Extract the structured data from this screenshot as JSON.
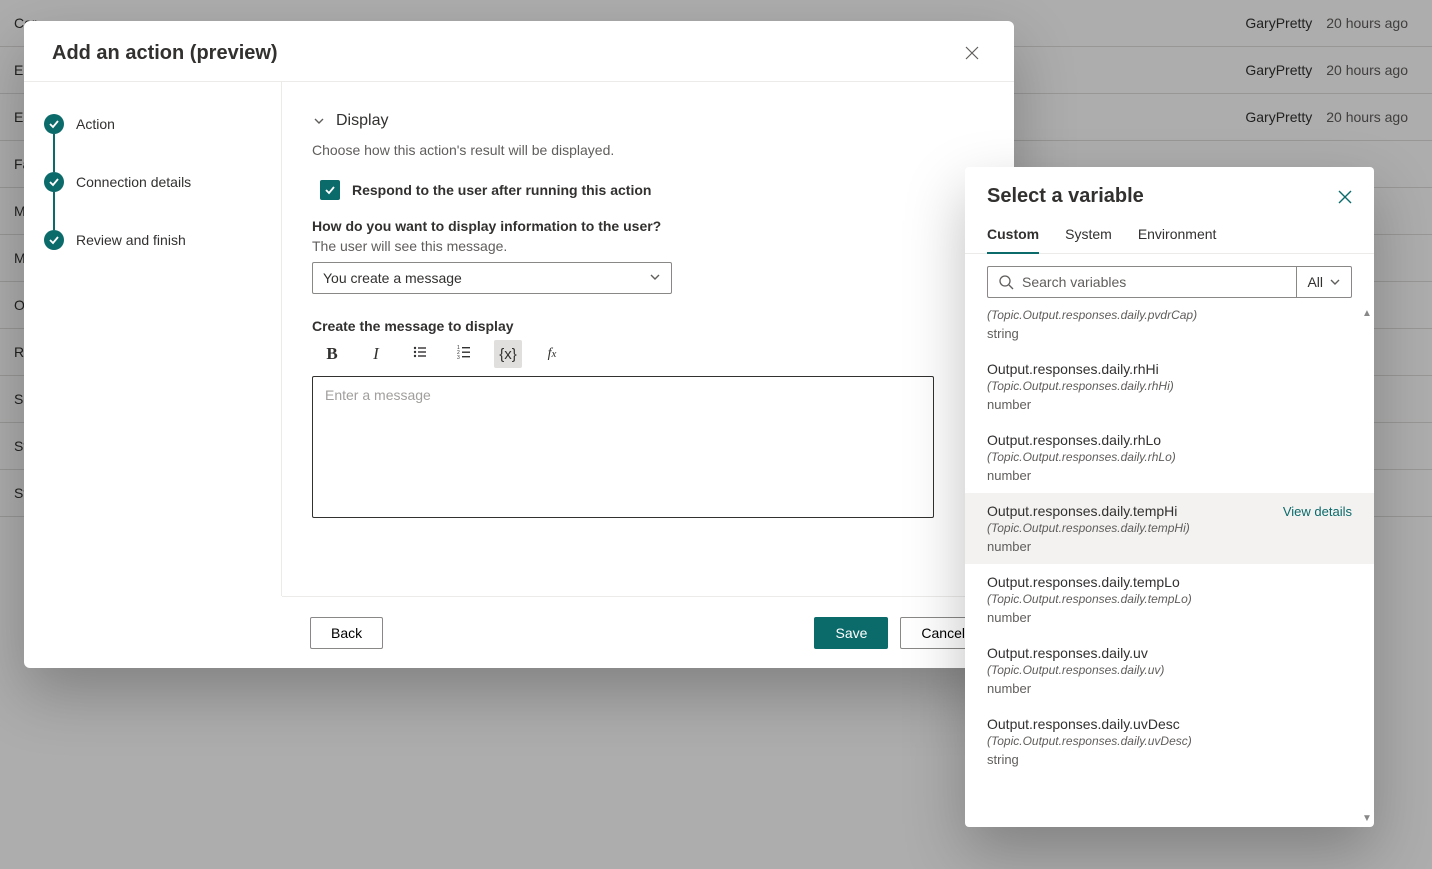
{
  "background_rows": [
    {
      "label": "Cor",
      "author": "GaryPretty",
      "time": "20 hours ago"
    },
    {
      "label": "End",
      "author": "GaryPretty",
      "time": "20 hours ago"
    },
    {
      "label": "Esc",
      "author": "GaryPretty",
      "time": "20 hours ago"
    },
    {
      "label": "Fall",
      "author": "",
      "time": ""
    },
    {
      "label": "MS",
      "author": "",
      "time": ""
    },
    {
      "label": "Mu",
      "author": "",
      "time": ""
    },
    {
      "label": "On",
      "author": "",
      "time": ""
    },
    {
      "label": "Res",
      "author": "",
      "time": ""
    },
    {
      "label": "Sig",
      "author": "",
      "time": ""
    },
    {
      "label": "Sta",
      "author": "",
      "time": ""
    },
    {
      "label": "Sta",
      "author": "",
      "time": ""
    }
  ],
  "modal": {
    "title": "Add an action (preview)",
    "steps": [
      "Action",
      "Connection details",
      "Review and finish"
    ],
    "section": {
      "title": "Display",
      "description": "Choose how this action's result will be displayed.",
      "respond_checkbox": "Respond to the user after running this action",
      "display_question": "How do you want to display information to the user?",
      "display_sub": "The user will see this message.",
      "select_value": "You create a message",
      "create_label": "Create the message to display",
      "editor_placeholder": "Enter a message",
      "toolbar": {
        "bold": "B",
        "italic": "I",
        "variable": "{x}",
        "formula": "fx"
      }
    },
    "footer": {
      "back": "Back",
      "save": "Save",
      "cancel": "Cancel"
    }
  },
  "var_panel": {
    "title": "Select a variable",
    "tabs": [
      "Custom",
      "System",
      "Environment"
    ],
    "search_placeholder": "Search variables",
    "filter_label": "All",
    "view_details": "View details",
    "items": [
      {
        "name": "",
        "path": "(Topic.Output.responses.daily.pvdrCap)",
        "type": "string",
        "hovered": false,
        "view": false,
        "truncated_top": true
      },
      {
        "name": "Output.responses.daily.rhHi",
        "path": "(Topic.Output.responses.daily.rhHi)",
        "type": "number",
        "hovered": false,
        "view": false
      },
      {
        "name": "Output.responses.daily.rhLo",
        "path": "(Topic.Output.responses.daily.rhLo)",
        "type": "number",
        "hovered": false,
        "view": false
      },
      {
        "name": "Output.responses.daily.tempHi",
        "path": "(Topic.Output.responses.daily.tempHi)",
        "type": "number",
        "hovered": true,
        "view": true
      },
      {
        "name": "Output.responses.daily.tempLo",
        "path": "(Topic.Output.responses.daily.tempLo)",
        "type": "number",
        "hovered": false,
        "view": false
      },
      {
        "name": "Output.responses.daily.uv",
        "path": "(Topic.Output.responses.daily.uv)",
        "type": "number",
        "hovered": false,
        "view": false
      },
      {
        "name": "Output.responses.daily.uvDesc",
        "path": "(Topic.Output.responses.daily.uvDesc)",
        "type": "string",
        "hovered": false,
        "view": false
      }
    ]
  }
}
